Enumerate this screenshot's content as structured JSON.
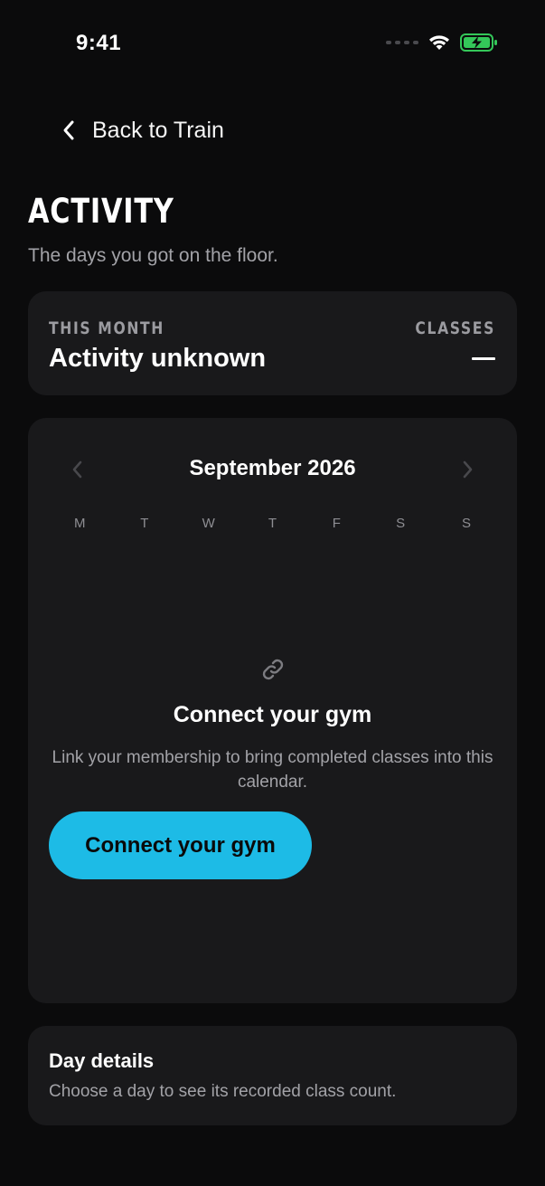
{
  "status_bar": {
    "time": "9:41",
    "icons": [
      "cellular-signal-icon",
      "wifi-icon",
      "battery-charging-icon"
    ],
    "battery_color": "#34c759"
  },
  "nav": {
    "back_label": "Back to Train"
  },
  "header": {
    "title": "ACTIVITY",
    "subtitle": "The days you got on the floor."
  },
  "month_summary": {
    "kicker_left": "THIS MONTH",
    "status": "Activity unknown",
    "kicker_right": "CLASSES",
    "classes_value": "—"
  },
  "calendar": {
    "month_year": "September 2026",
    "weekdays": [
      "M",
      "T",
      "W",
      "T",
      "F",
      "S",
      "S"
    ],
    "empty_state": {
      "icon": "link-icon",
      "title": "Connect your gym",
      "text": "Link your membership to bring completed classes into this calendar.",
      "button_label": "Connect your gym"
    }
  },
  "day_details": {
    "title": "Day details",
    "text": "Choose a day to see its recorded class count."
  },
  "colors": {
    "background": "#0b0b0c",
    "card": "#19191b",
    "accent": "#1dbbe6",
    "muted_text": "#a2a2a7"
  }
}
